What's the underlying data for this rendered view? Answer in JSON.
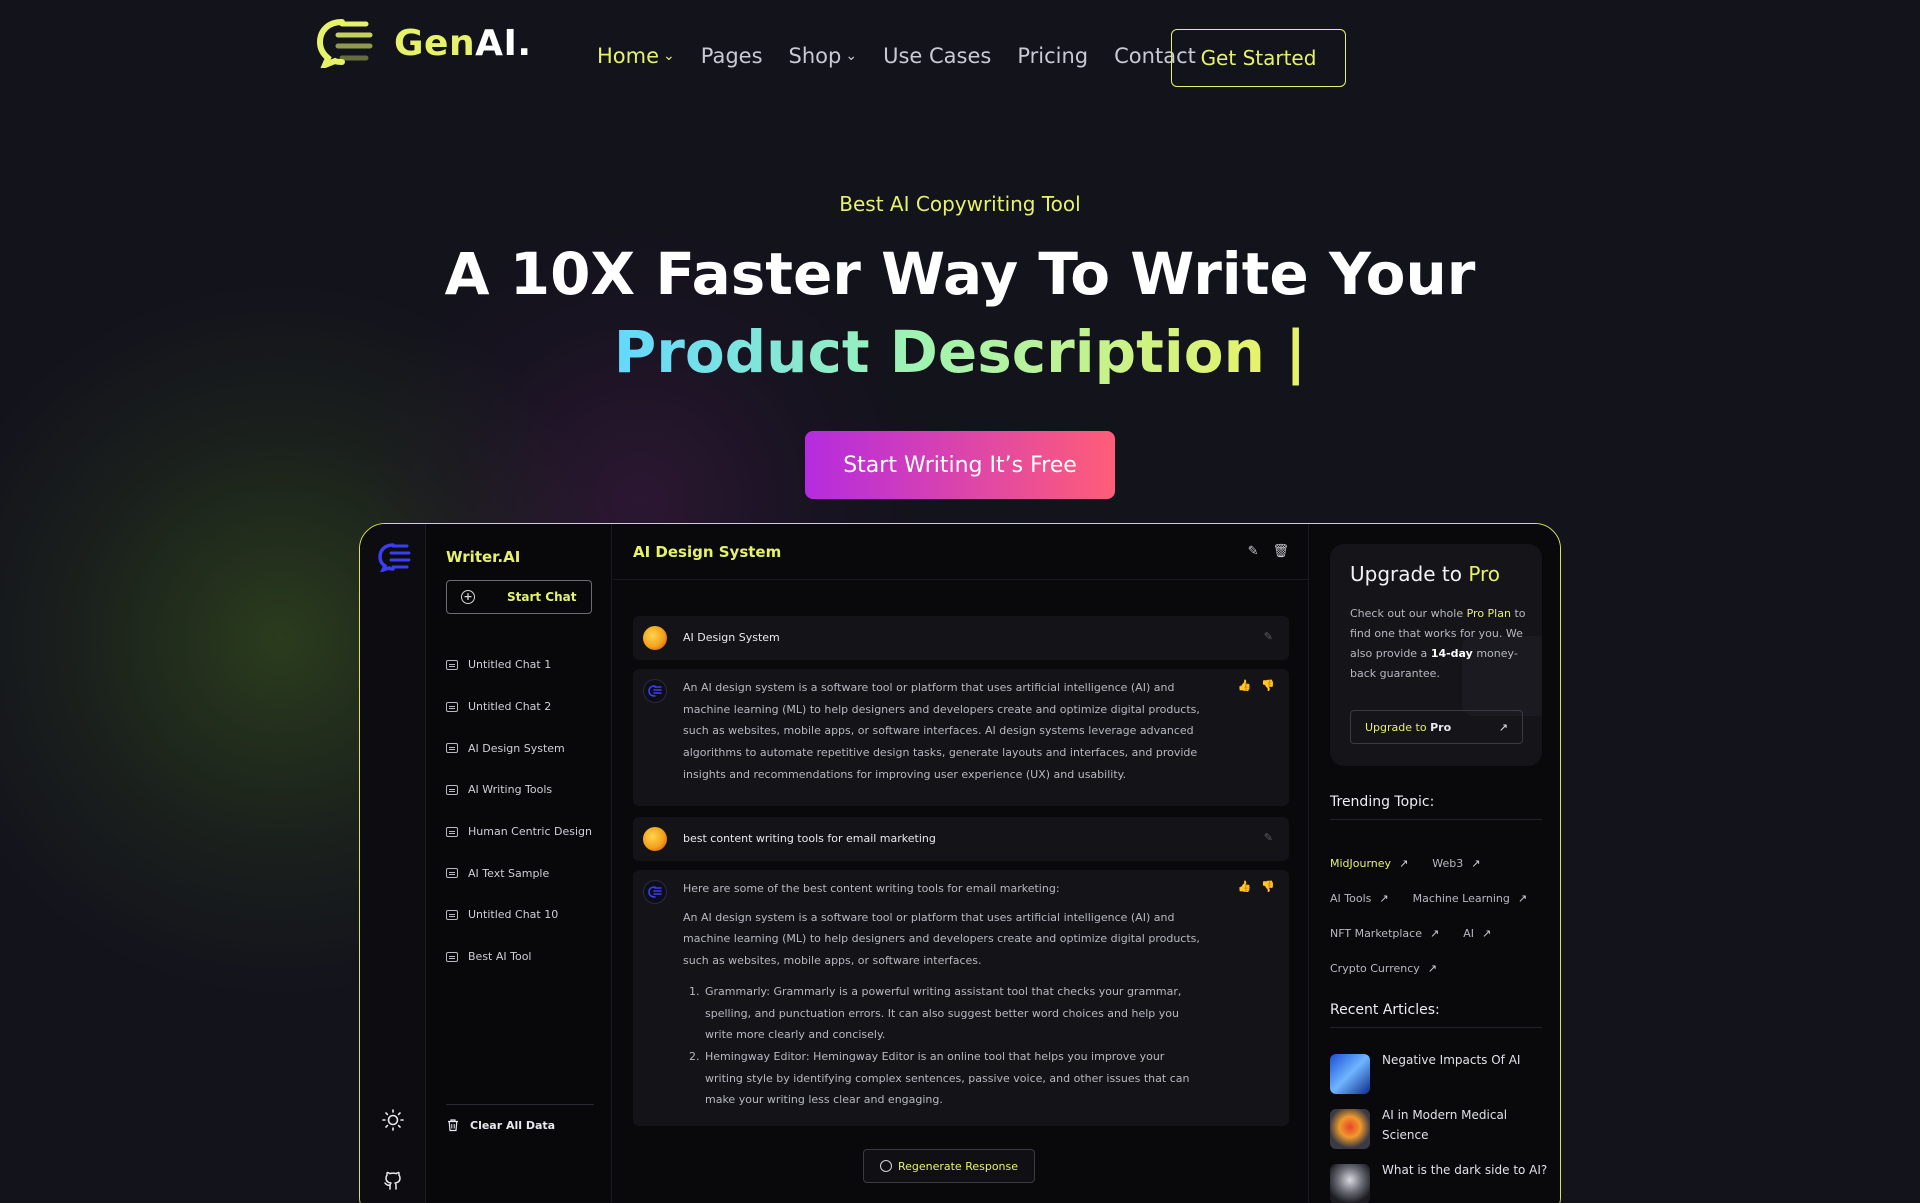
{
  "brand": {
    "name_part1": "Gen",
    "name_part2": "AI."
  },
  "nav": {
    "items": [
      {
        "label": "Home",
        "chev": "⌄"
      },
      {
        "label": "Pages"
      },
      {
        "label": "Shop",
        "chev": "⌄"
      },
      {
        "label": "Use Cases"
      },
      {
        "label": "Pricing"
      },
      {
        "label": "Contact"
      }
    ],
    "cta": "Get Started"
  },
  "hero": {
    "eyebrow": "Best AI Copywriting Tool",
    "title_line1": "A 10X Faster Way To Write Your",
    "title_line2": "Product Description",
    "caret": "|",
    "cta": "Start Writing It’s Free"
  },
  "app": {
    "sidebar": {
      "title": "Writer.AI",
      "start_chat": "Start Chat",
      "chats": [
        "Untitled Chat 1",
        "Untitled Chat 2",
        "AI Design System",
        "AI Writing Tools",
        "Human Centric Design",
        "AI Text Sample",
        "Untitled Chat 10",
        "Best AI Tool"
      ],
      "clear": "Clear All Data"
    },
    "main": {
      "title": "AI Design System",
      "q1": "AI Design System",
      "a1": "An AI design system is a software tool or platform that uses artificial intelligence (AI) and machine learning (ML) to help designers and developers create and optimize digital products, such as websites, mobile apps, or software interfaces. AI design systems leverage advanced algorithms to automate repetitive design tasks, generate layouts and interfaces, and provide insights and recommendations for improving user experience (UX) and usability.",
      "q2": "best content writing tools for email marketing",
      "a2_intro": "Here are some of the best content writing tools for email marketing:",
      "a2_body": "An AI design system is a software tool or platform that uses artificial intelligence (AI) and machine learning (ML) to help designers and developers create and optimize digital products, such as websites, mobile apps, or software interfaces.",
      "a2_list": [
        "Grammarly: Grammarly is a powerful writing assistant tool that checks your grammar, spelling, and punctuation errors. It can also suggest better word choices and help you write more clearly and concisely.",
        "Hemingway Editor: Hemingway Editor is an online tool that helps you improve your writing style by identifying complex sentences, passive voice, and other issues that can make your writing less clear and engaging."
      ],
      "regen": "Regenerate Response"
    },
    "right": {
      "upgrade_title_a": "Upgrade to ",
      "upgrade_title_b": "Pro",
      "desc_a": "Check out our whole ",
      "desc_hl": "Pro Plan",
      "desc_b": " to find one that works for you. We also provide a ",
      "desc_bold": "14-day",
      "desc_c": " money-back guarantee.",
      "btn_a": "Upgrade to ",
      "btn_b": "Pro",
      "trending_title": "Trending Topic:",
      "topics": [
        [
          "MidJourney",
          "Web3"
        ],
        [
          "AI Tools",
          "Machine Learning"
        ],
        [
          "NFT Marketplace",
          "AI"
        ],
        [
          "Crypto Currency"
        ]
      ],
      "recent_title": "Recent Articles:",
      "articles": [
        "Negative Impacts Of AI",
        "AI in Modern Medical Science",
        "What is the dark side to AI?"
      ]
    }
  },
  "colors": {
    "accent": "#e6f26a",
    "cta_from": "#b52be0",
    "cta_to": "#ff5d78"
  }
}
